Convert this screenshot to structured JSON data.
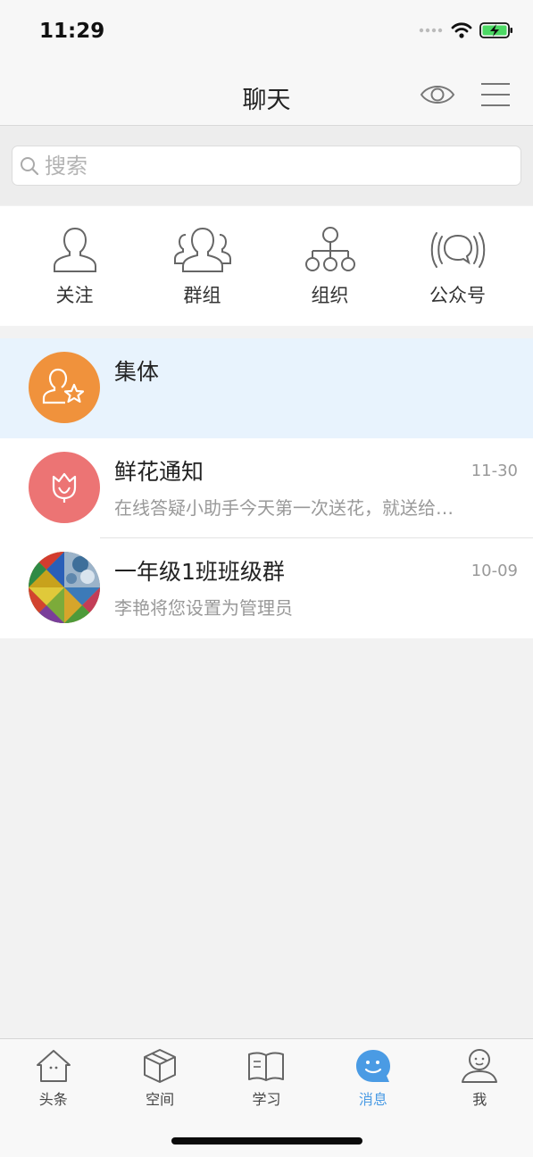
{
  "status_bar": {
    "time": "11:29"
  },
  "nav": {
    "title": "聊天"
  },
  "search": {
    "placeholder": "搜索"
  },
  "quick_actions": [
    {
      "label": "关注",
      "icon": "person-outline-icon"
    },
    {
      "label": "群组",
      "icon": "group-outline-icon"
    },
    {
      "label": "组织",
      "icon": "org-tree-icon"
    },
    {
      "label": "公众号",
      "icon": "broadcast-chat-icon"
    }
  ],
  "chats": [
    {
      "name": "集体",
      "time": "",
      "preview": "",
      "avatar_color": "#f0923c",
      "selected": true
    },
    {
      "name": "鲜花通知",
      "time": "11-30",
      "preview": "在线答疑小助手今天第一次送花，就送给…",
      "avatar_color": "#ec7474"
    },
    {
      "name": "一年级1班班级群",
      "time": "10-09",
      "preview": "李艳将您设置为管理员"
    }
  ],
  "tabs": [
    {
      "label": "头条",
      "icon": "home-icon"
    },
    {
      "label": "空间",
      "icon": "cube-icon"
    },
    {
      "label": "学习",
      "icon": "book-icon"
    },
    {
      "label": "消息",
      "icon": "message-smile-icon",
      "active": true
    },
    {
      "label": "我",
      "icon": "profile-icon"
    }
  ],
  "colors": {
    "accent": "#4a9be4",
    "selected_row": "#e8f3fd"
  }
}
